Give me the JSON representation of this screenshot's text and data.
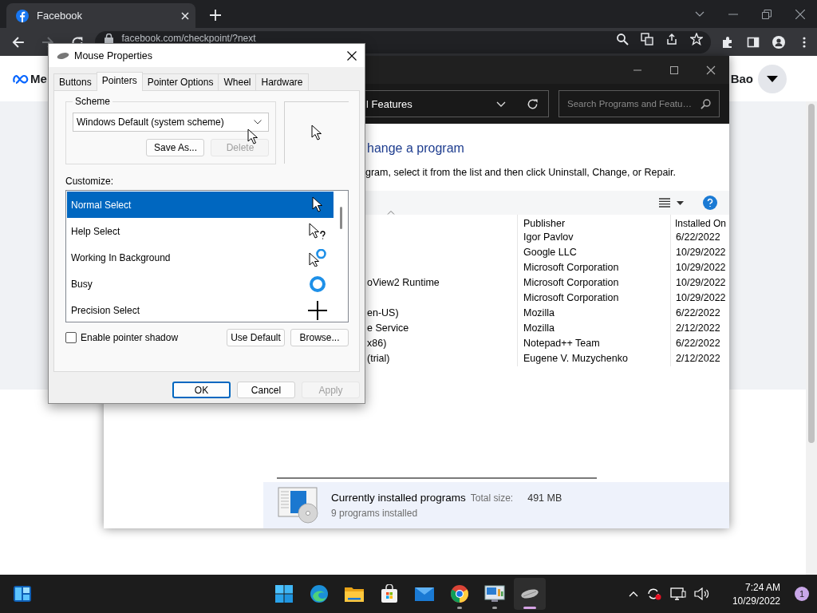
{
  "browser": {
    "tabs": [
      {
        "title": "Facebook",
        "selected": true
      }
    ],
    "url": "facebook.com/checkpoint/?next"
  },
  "page": {
    "logo_text": "Me",
    "user_name": "Bao"
  },
  "control_panel": {
    "breadcrumb": "l Features",
    "search": {
      "placeholder": "Search Programs and Featu…"
    },
    "heading": "hange a program",
    "instructions": "gram, select it from the list and then click Uninstall, Change, or Repair.",
    "columns": [
      "Publisher",
      "Installed On"
    ],
    "rows": [
      {
        "publisher": "Igor Pavlov",
        "installed_on": "6/22/2022"
      },
      {
        "publisher": "Google LLC",
        "installed_on": "10/29/2022"
      },
      {
        "publisher": "Microsoft Corporation",
        "installed_on": "10/29/2022"
      },
      {
        "name": "oView2 Runtime",
        "publisher": "Microsoft Corporation",
        "installed_on": "10/29/2022"
      },
      {
        "publisher": "Microsoft Corporation",
        "installed_on": "10/29/2022"
      },
      {
        "name": "en-US)",
        "publisher": "Mozilla",
        "installed_on": "6/22/2022"
      },
      {
        "name": "e Service",
        "publisher": "Mozilla",
        "installed_on": "2/12/2022"
      },
      {
        "name": "x86)",
        "publisher": "Notepad++ Team",
        "installed_on": "6/22/2022"
      },
      {
        "name": "(trial)",
        "publisher": "Eugene V. Muzychenko",
        "installed_on": "2/12/2022"
      }
    ],
    "details": {
      "title": "Currently installed programs",
      "size_label": "Total size:",
      "size": "491 MB",
      "count": "9 programs installed"
    }
  },
  "dialog": {
    "title": "Mouse Properties",
    "tabs": [
      {
        "label": "Buttons",
        "selected": false
      },
      {
        "label": "Pointers",
        "selected": true
      },
      {
        "label": "Pointer Options",
        "selected": false
      },
      {
        "label": "Wheel",
        "selected": false
      },
      {
        "label": "Hardware",
        "selected": false
      }
    ],
    "scheme_label": "Scheme",
    "scheme": "Windows Default (system scheme)",
    "scheme_buttons": [
      {
        "label": "Save As...",
        "disabled": false
      },
      {
        "label": "Delete",
        "disabled": true
      }
    ],
    "customize_label": "Customize:",
    "pointers": [
      {
        "name": "Normal Select",
        "kind": "arrow",
        "selected": true
      },
      {
        "name": "Help Select",
        "kind": "help",
        "selected": false
      },
      {
        "name": "Working In Background",
        "kind": "working",
        "selected": false
      },
      {
        "name": "Busy",
        "kind": "busy",
        "selected": false
      },
      {
        "name": "Precision Select",
        "kind": "cross",
        "selected": false
      }
    ],
    "shadow": {
      "label": "Enable pointer shadow",
      "checked": false
    },
    "pointer_buttons": [
      "Use Default",
      "Browse..."
    ],
    "buttons": [
      {
        "label": "OK",
        "default": true,
        "disabled": false
      },
      {
        "label": "Cancel",
        "default": false,
        "disabled": false
      },
      {
        "label": "Apply",
        "default": false,
        "disabled": true
      }
    ]
  },
  "taskbar": {
    "apps": [
      {
        "kind": "start",
        "running": false,
        "active": false
      },
      {
        "kind": "edge",
        "running": false,
        "active": false
      },
      {
        "kind": "folder",
        "running": false,
        "active": false
      },
      {
        "kind": "store",
        "running": false,
        "active": false
      },
      {
        "kind": "mail",
        "running": false,
        "active": false
      },
      {
        "kind": "chrome",
        "running": true,
        "active": false
      },
      {
        "kind": "control",
        "running": true,
        "active": false
      },
      {
        "kind": "mouse",
        "running": true,
        "active": true
      }
    ],
    "time": "7:24 AM",
    "date": "10/29/2022",
    "notifications": "1"
  }
}
